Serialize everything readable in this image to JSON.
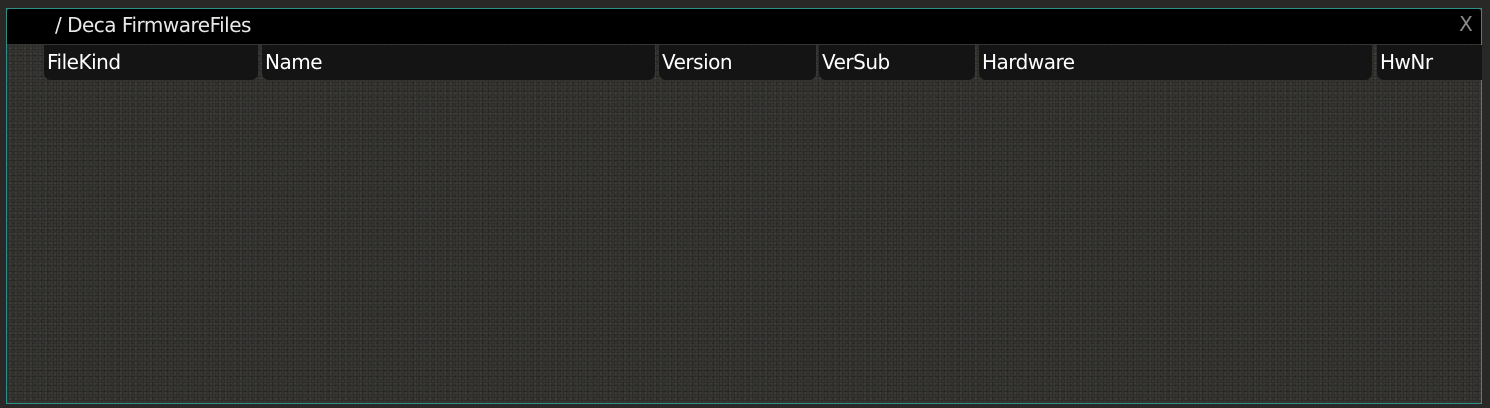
{
  "window": {
    "title": "/ Deca FirmwareFiles",
    "close_label": "X"
  },
  "table": {
    "columns": [
      "FileKind",
      "Name",
      "Version",
      "VerSub",
      "Hardware",
      "HwNr"
    ],
    "rows": []
  },
  "colors": {
    "border_accent": "#2f8f86",
    "titlebar_bg": "#000000",
    "header_bg": "#151414",
    "body_bg": "#3a3936"
  }
}
